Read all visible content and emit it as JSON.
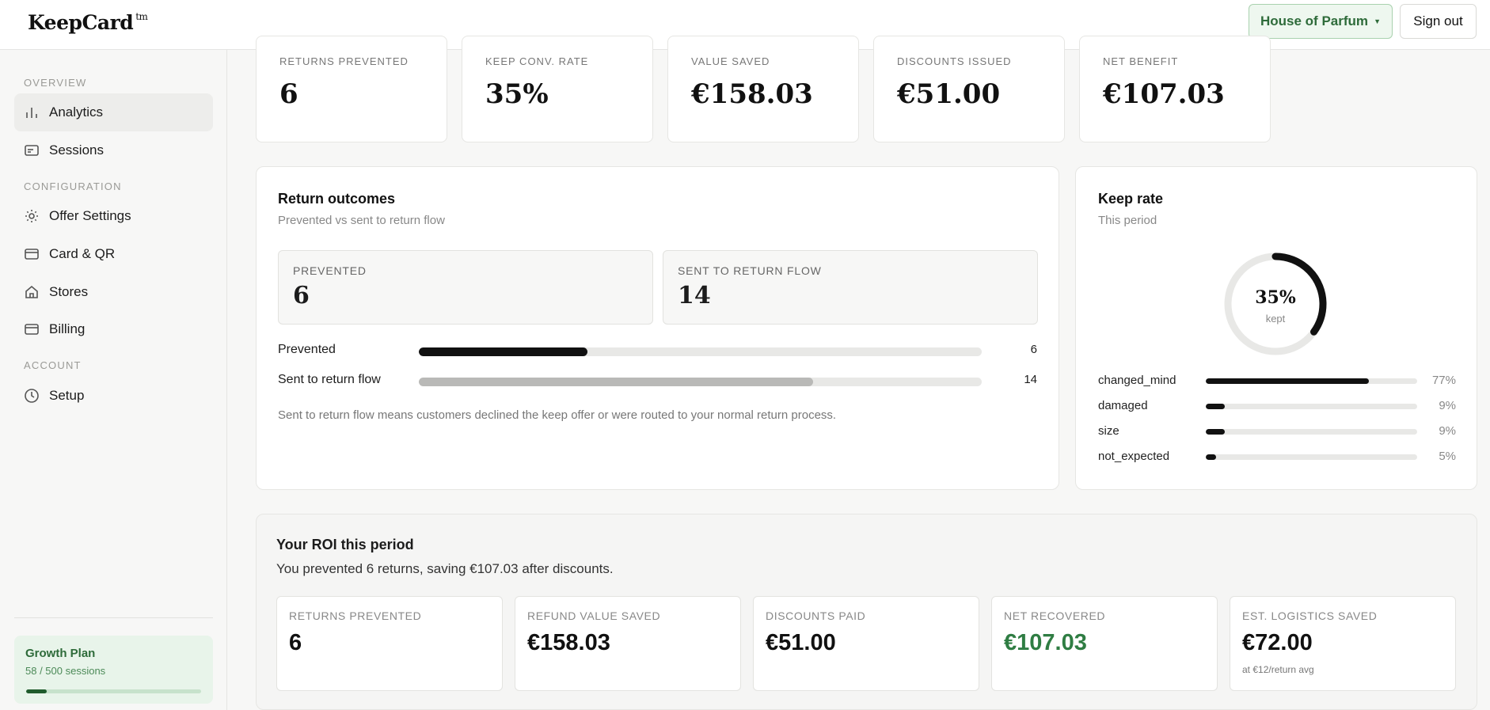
{
  "brand": {
    "name": "KeepCard",
    "mark": "tm"
  },
  "header": {
    "store": "House of Parfum",
    "sign_out": "Sign out"
  },
  "sidebar": {
    "sections": {
      "overview": "OVERVIEW",
      "configuration": "CONFIGURATION",
      "account": "ACCOUNT"
    },
    "items": [
      {
        "label": "Analytics",
        "icon": "bar-chart-icon",
        "active": true
      },
      {
        "label": "Sessions",
        "icon": "card-icon"
      },
      {
        "label": "Offer Settings",
        "icon": "gear-icon"
      },
      {
        "label": "Card & QR",
        "icon": "credit-card-icon"
      },
      {
        "label": "Stores",
        "icon": "home-icon"
      },
      {
        "label": "Billing",
        "icon": "billing-card-icon"
      },
      {
        "label": "Setup",
        "icon": "clock-icon"
      }
    ],
    "plan": {
      "name": "Growth Plan",
      "usage": "58 / 500 sessions",
      "used": 58,
      "limit": 500
    }
  },
  "stats": [
    {
      "label": "RETURNS PREVENTED",
      "value": "6"
    },
    {
      "label": "KEEP CONV. RATE",
      "value": "35%"
    },
    {
      "label": "VALUE SAVED",
      "value": "€158.03"
    },
    {
      "label": "DISCOUNTS ISSUED",
      "value": "€51.00"
    },
    {
      "label": "NET BENEFIT",
      "value": "€107.03"
    }
  ],
  "outcomes": {
    "title": "Return outcomes",
    "subtitle": "Prevented vs sent to return flow",
    "boxes": [
      {
        "label": "PREVENTED",
        "value": "6"
      },
      {
        "label": "SENT TO RETURN FLOW",
        "value": "14"
      }
    ],
    "bars": [
      {
        "label": "Prevented",
        "value": 6,
        "color": "#111111"
      },
      {
        "label": "Sent to return flow",
        "value": 14,
        "color": "#b9b9b7"
      }
    ],
    "total": 20,
    "note": "Sent to return flow means customers declined the keep offer or were routed to your normal return process."
  },
  "keep_rate": {
    "title": "Keep rate",
    "subtitle": "This period",
    "percent": 35,
    "percent_label": "35%",
    "caption": "kept",
    "reasons": [
      {
        "label": "changed_mind",
        "value": 77,
        "pct": "77%"
      },
      {
        "label": "damaged",
        "value": 9,
        "pct": "9%"
      },
      {
        "label": "size",
        "value": 9,
        "pct": "9%"
      },
      {
        "label": "not_expected",
        "value": 5,
        "pct": "5%"
      }
    ]
  },
  "roi": {
    "title": "Your ROI this period",
    "subtitle": "You prevented 6 returns, saving €107.03 after discounts.",
    "cards": [
      {
        "label": "RETURNS PREVENTED",
        "value": "6"
      },
      {
        "label": "REFUND VALUE SAVED",
        "value": "€158.03"
      },
      {
        "label": "DISCOUNTS PAID",
        "value": "€51.00"
      },
      {
        "label": "NET RECOVERED",
        "value": "€107.03",
        "color": "#2f7d43"
      },
      {
        "label": "EST. LOGISTICS SAVED",
        "value": "€72.00",
        "foot": "at €12/return avg"
      }
    ]
  }
}
